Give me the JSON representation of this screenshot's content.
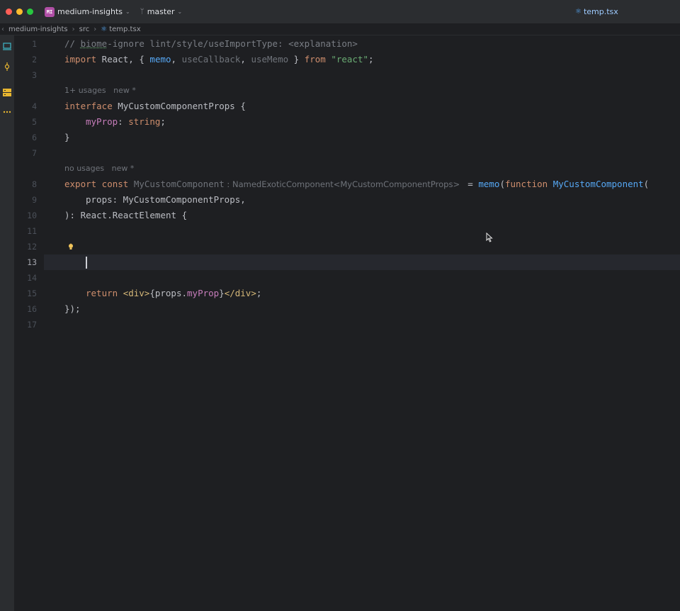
{
  "titlebar": {
    "project_initials": "MI",
    "project_name": "medium-insights",
    "branch": "master",
    "open_tab": "temp.tsx"
  },
  "breadcrumb": [
    "medium-insights",
    "src",
    "temp.tsx"
  ],
  "editor": {
    "line_numbers": [
      "1",
      "2",
      "3",
      "4",
      "5",
      "6",
      "7",
      "8",
      "9",
      "10",
      "11",
      "12",
      "13",
      "14",
      "15",
      "16",
      "17"
    ],
    "current_line": "13",
    "inlay_hints": {
      "usages_4": "1+ usages   new *",
      "usages_8": "no usages   new *"
    },
    "code": {
      "l1_comment": "// ",
      "l1_biome": "biome",
      "l1_rest": "-ignore lint/style/useImportType: <explanation>",
      "l2_import": "import",
      "l2_react": " React, { ",
      "l2_memo": "memo",
      "l2_comma1": ", ",
      "l2_usecallback": "useCallback",
      "l2_comma2": ", ",
      "l2_usememo": "useMemo",
      "l2_close": " } ",
      "l2_from": "from",
      "l2_str": " \"react\"",
      "l2_semi": ";",
      "l4_interface": "interface",
      "l4_name": " MyCustomComponentProps {",
      "l5_prop": "myProp",
      "l5_colon": ": ",
      "l5_type": "string",
      "l5_semi": ";",
      "l6": "}",
      "l8_export": "export",
      "l8_const": " const ",
      "l8_name": "MyCustomComponent",
      "l8_hint": " : NamedExoticComponent<MyCustomComponentProps> ",
      "l8_eq": " = ",
      "l8_memo": "memo",
      "l8_paren": "(",
      "l8_function": "function",
      "l8_space": " ",
      "l8_fnname": "MyCustomComponent",
      "l8_paren2": "(",
      "l9": "props: MyCustomComponentProps,",
      "l10": "): React.ReactElement {",
      "l15_return": "return",
      "l15_sp": " ",
      "l15_open": "<div>",
      "l15_brace1": "{props.",
      "l15_prop": "myProp",
      "l15_brace2": "}",
      "l15_close": "</div>",
      "l15_semi": ";",
      "l16": "});"
    }
  },
  "colors": {
    "keyword": "#cf8e6d",
    "function": "#56a8f5",
    "string": "#6aab73",
    "property": "#c77dbb",
    "comment": "#7a7e85",
    "tag": "#d5b778"
  }
}
